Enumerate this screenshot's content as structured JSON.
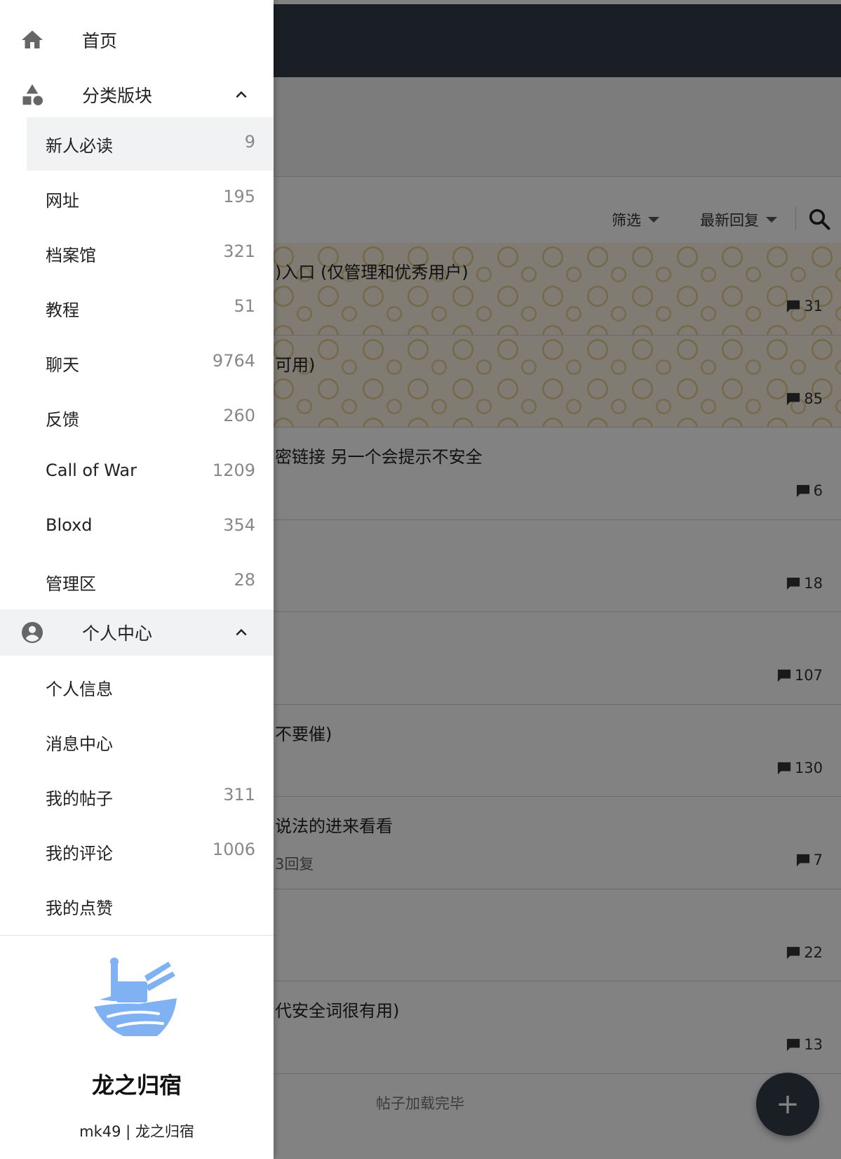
{
  "background": {
    "filter_label": "筛选",
    "sort_label": "最新回复",
    "posts": [
      {
        "title": ")入口 (仅管理和优秀用户)",
        "sub": "",
        "count": "31",
        "pattern": true
      },
      {
        "title": "可用)",
        "sub": "",
        "count": "85",
        "pattern": true
      },
      {
        "title": "密链接 另一个会提示不安全",
        "sub": "",
        "count": "6",
        "pattern": false
      },
      {
        "title": "",
        "sub": "",
        "count": "18",
        "pattern": false
      },
      {
        "title": "",
        "sub": "",
        "count": "107",
        "pattern": false
      },
      {
        "title": "不要催)",
        "sub": "",
        "count": "130",
        "pattern": false
      },
      {
        "title": "说法的进来看看",
        "sub": "3回复",
        "count": "7",
        "pattern": false
      },
      {
        "title": "",
        "sub": "",
        "count": "22",
        "pattern": false
      },
      {
        "title": "代安全词很有用)",
        "sub": "",
        "count": "13",
        "pattern": false
      }
    ],
    "loaded_text": "帖子加载完毕",
    "fab_label": "+"
  },
  "drawer": {
    "home_label": "首页",
    "categories_label": "分类版块",
    "categories": [
      {
        "label": "新人必读",
        "count": "9"
      },
      {
        "label": "网址",
        "count": "195"
      },
      {
        "label": "档案馆",
        "count": "321"
      },
      {
        "label": "教程",
        "count": "51"
      },
      {
        "label": "聊天",
        "count": "9764"
      },
      {
        "label": "反馈",
        "count": "260"
      },
      {
        "label": "Call of War",
        "count": "1209"
      },
      {
        "label": "Bloxd",
        "count": "354"
      },
      {
        "label": "管理区",
        "count": "28"
      }
    ],
    "personal_label": "个人中心",
    "personal": [
      {
        "label": "个人信息",
        "count": ""
      },
      {
        "label": "消息中心",
        "count": ""
      },
      {
        "label": "我的帖子",
        "count": "311"
      },
      {
        "label": "我的评论",
        "count": "1006"
      },
      {
        "label": "我的点赞",
        "count": ""
      }
    ],
    "site_name": "龙之归宿",
    "footer": "mk49 | 龙之归宿"
  },
  "colors": {
    "topbar": "#343d4b",
    "logo_blue": "#7fb1f3",
    "selected_bg": "#f1f2f4"
  }
}
